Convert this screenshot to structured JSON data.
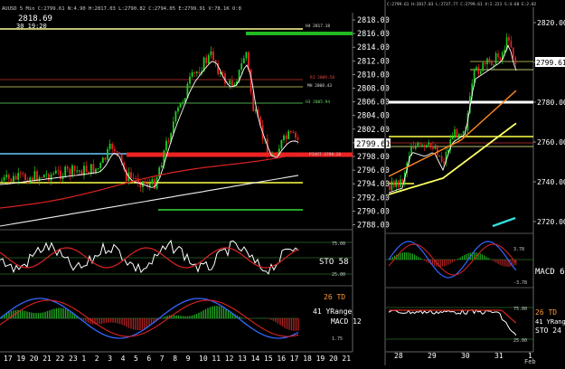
{
  "left_chart": {
    "header": "AUUSD 5 Min C:2799.61 N:4.90 H:2817.03 L:2790.82 C:2794.05 E:2799.91 V:78.1K O:8",
    "session_label": "2818.69",
    "session_sub": "30 19:20",
    "y_ticks": [
      "2818.00",
      "2816.00",
      "2814.00",
      "2812.00",
      "2810.00",
      "2808.00",
      "2806.00",
      "2804.00",
      "2802.00",
      "2800.00",
      "2798.00",
      "2796.00",
      "2794.00",
      "2792.00",
      "2790.00",
      "2788.00"
    ],
    "last_price": "2799.61",
    "x_ticks": [
      "17",
      "19",
      "20",
      "21",
      "22",
      "23",
      "1",
      "2",
      "3",
      "4",
      "5",
      "6",
      "7",
      "8",
      "9",
      "10",
      "11",
      "12",
      "13",
      "14",
      "15",
      "16",
      "17",
      "18",
      "19",
      "20",
      "21"
    ],
    "level_labels": {
      "h4": "H4 2817.18",
      "r1": "R1 2809.58",
      "mh": "MH 2808.43",
      "h3": "H3 2805.94",
      "pivot": "PIVOT 2798.26",
      "s1": "S1 2796.35"
    },
    "sto_label": "STO 58",
    "sto_levels": [
      "75.00",
      "50.00",
      "25.00"
    ],
    "td_label": "26 TD",
    "yrange_label": "41 YRange",
    "macd_label": "MACD 12",
    "macd_level": "1.75",
    "colors": {
      "up": "#22cc22",
      "down": "#ee2222",
      "ma1": "#ffffff",
      "ma2": "#dd2222",
      "ma3": "#ffff66"
    }
  },
  "right_chart": {
    "header": "C:2799.61 H:2817.03 L:2737.77 C:2799.61 V:2.221 S:4.68 E:2.02",
    "y_ticks": [
      "2820.00",
      "2800.00",
      "2780.00",
      "2760.00",
      "2740.00",
      "2720.00"
    ],
    "last_price": "2799.61",
    "x_ticks": [
      "28",
      "29",
      "30",
      "31",
      "1"
    ],
    "x_sub": "Feb",
    "macd_label": "MACD 6",
    "macd_levels": [
      "3.78",
      "-3.78"
    ],
    "td_label": "26 TD",
    "yrange_label": "41 YRange",
    "sto_label": "STO 24",
    "sto_levels": [
      "75.00",
      "25.00"
    ]
  }
}
